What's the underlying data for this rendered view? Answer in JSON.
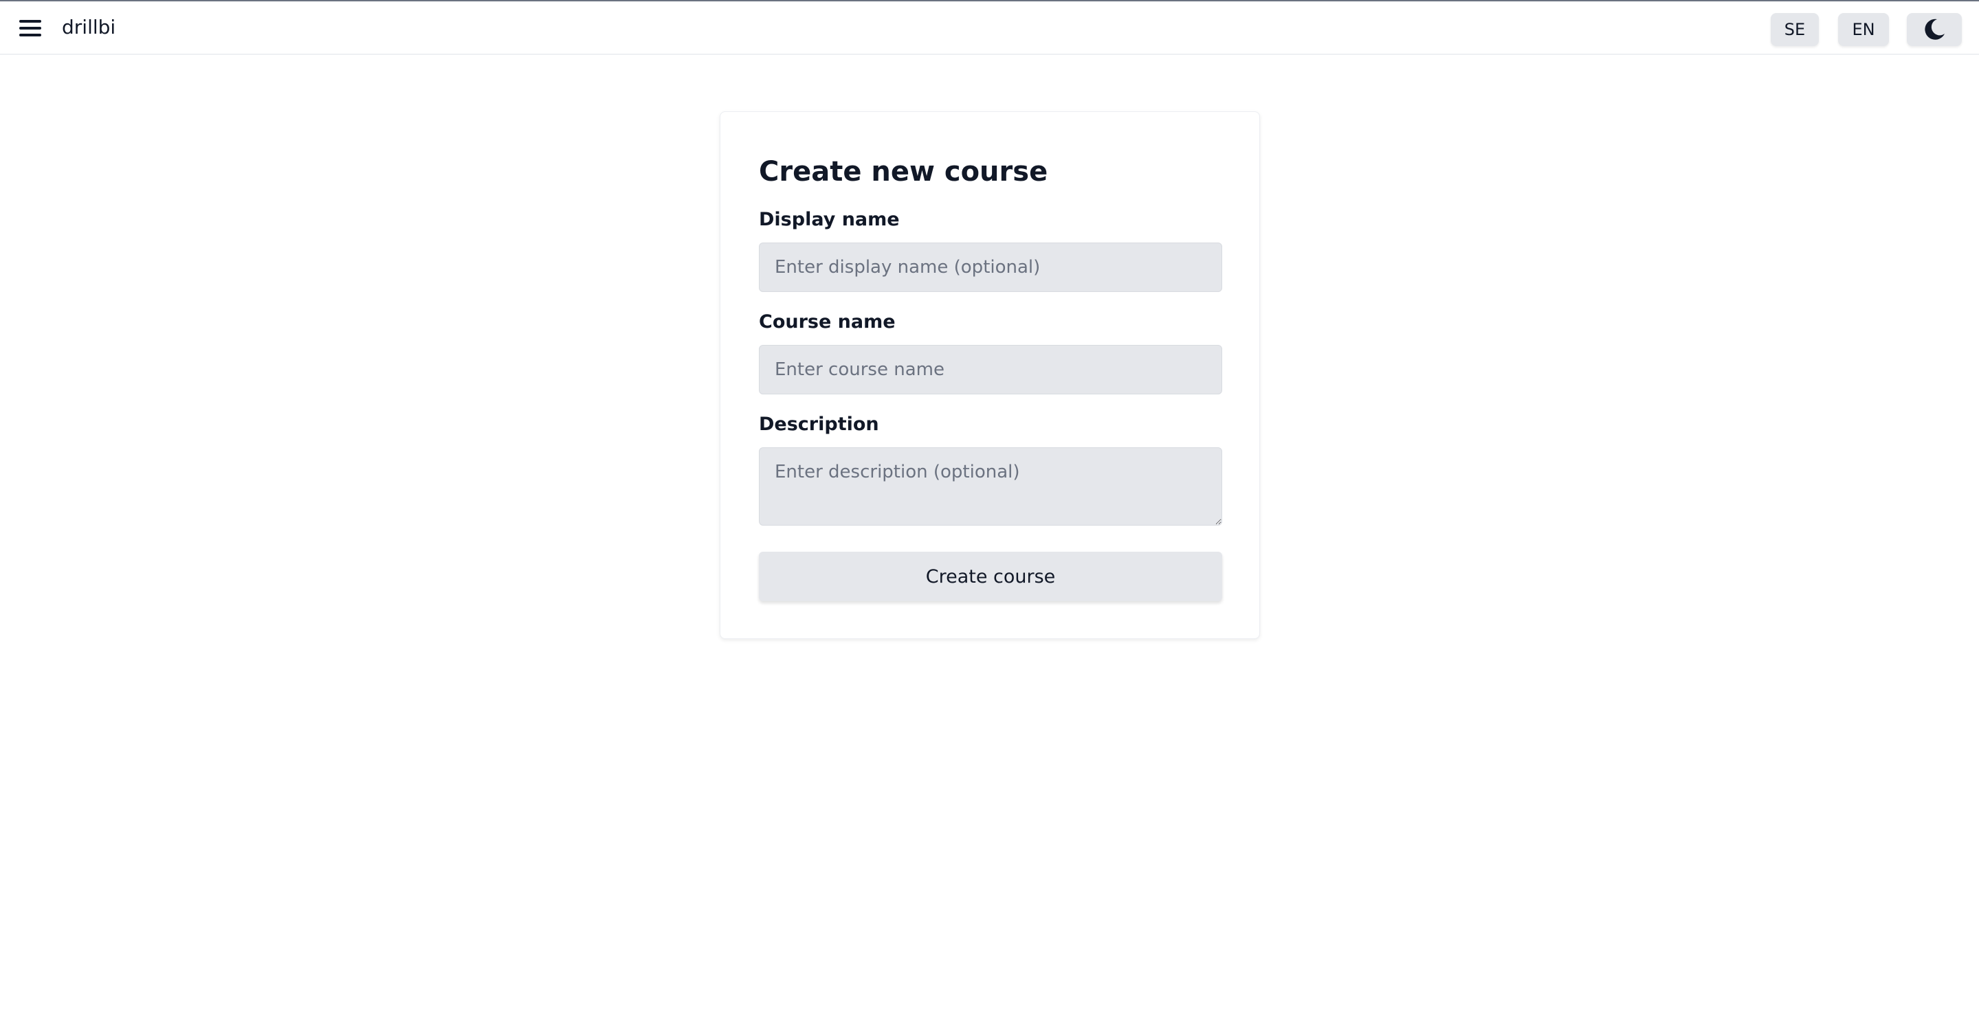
{
  "header": {
    "menu_icon": "hamburger-menu-icon",
    "brand": "drillbi",
    "lang_se": "SE",
    "lang_en": "EN",
    "theme_icon": "moon-icon"
  },
  "form": {
    "title": "Create new course",
    "display_name": {
      "label": "Display name",
      "placeholder": "Enter display name (optional)",
      "value": ""
    },
    "course_name": {
      "label": "Course name",
      "placeholder": "Enter course name",
      "value": ""
    },
    "description": {
      "label": "Description",
      "placeholder": "Enter description (optional)",
      "value": ""
    },
    "submit_label": "Create course"
  }
}
